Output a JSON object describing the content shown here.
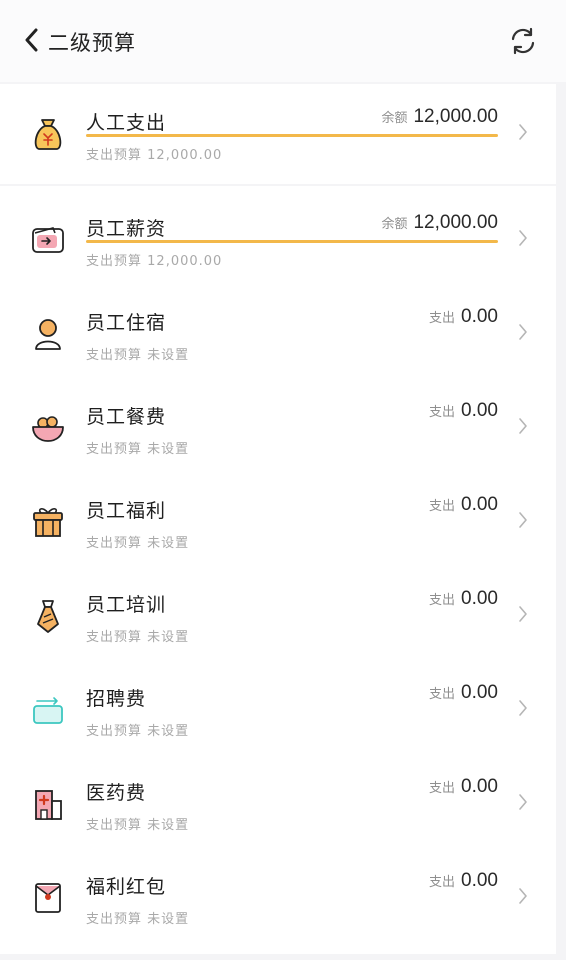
{
  "header": {
    "title": "二级预算"
  },
  "summary": {
    "name": "人工支出",
    "right_label": "余额",
    "right_value": "12,000.00",
    "sub_label": "支出预算",
    "sub_value": "12,000.00",
    "progress": 1.0,
    "icon": "money-bag-icon"
  },
  "items": [
    {
      "name": "员工薪资",
      "right_label": "余额",
      "right_value": "12,000.00",
      "sub_label": "支出预算",
      "sub_value": "12,000.00",
      "progress": 1.0,
      "icon": "wallet-icon"
    },
    {
      "name": "员工住宿",
      "right_label": "支出",
      "right_value": "0.00",
      "sub_label": "支出预算",
      "sub_value": "未设置",
      "icon": "person-icon"
    },
    {
      "name": "员工餐费",
      "right_label": "支出",
      "right_value": "0.00",
      "sub_label": "支出预算",
      "sub_value": "未设置",
      "icon": "bowl-icon"
    },
    {
      "name": "员工福利",
      "right_label": "支出",
      "right_value": "0.00",
      "sub_label": "支出预算",
      "sub_value": "未设置",
      "icon": "gift-icon"
    },
    {
      "name": "员工培训",
      "right_label": "支出",
      "right_value": "0.00",
      "sub_label": "支出预算",
      "sub_value": "未设置",
      "icon": "tie-icon"
    },
    {
      "name": "招聘费",
      "right_label": "支出",
      "right_value": "0.00",
      "sub_label": "支出预算",
      "sub_value": "未设置",
      "icon": "card-icon"
    },
    {
      "name": "医药费",
      "right_label": "支出",
      "right_value": "0.00",
      "sub_label": "支出预算",
      "sub_value": "未设置",
      "icon": "hospital-icon"
    },
    {
      "name": "福利红包",
      "right_label": "支出",
      "right_value": "0.00",
      "sub_label": "支出预算",
      "sub_value": "未设置",
      "icon": "red-envelope-icon"
    }
  ]
}
